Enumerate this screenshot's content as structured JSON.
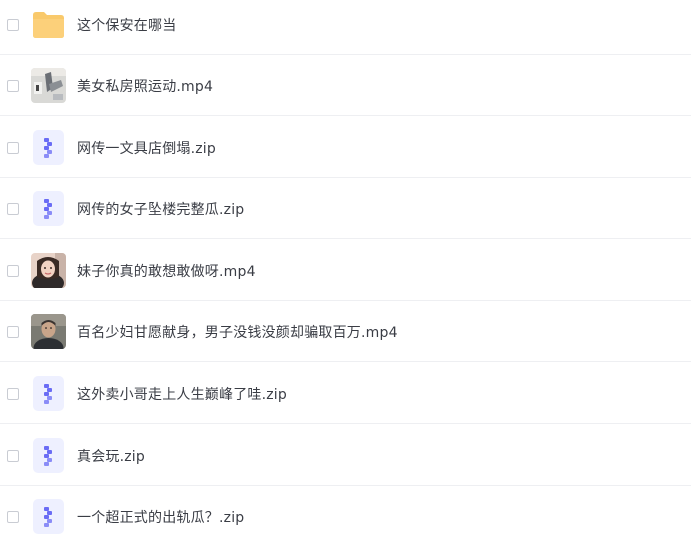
{
  "files": [
    {
      "name": "这个保安在哪当",
      "icon": "folder-icon"
    },
    {
      "name": "美女私房照运动.mp4",
      "icon": "video-thumbnail"
    },
    {
      "name": "网传一文具店倒塌.zip",
      "icon": "zip-icon"
    },
    {
      "name": "网传的女子坠楼完整瓜.zip",
      "icon": "zip-icon"
    },
    {
      "name": "妹子你真的敢想敢做呀.mp4",
      "icon": "video-thumbnail"
    },
    {
      "name": "百名少妇甘愿献身，男子没钱没颜却骗取百万.mp4",
      "icon": "video-thumbnail"
    },
    {
      "name": "这外卖小哥走上人生巅峰了哇.zip",
      "icon": "zip-icon"
    },
    {
      "name": "真会玩.zip",
      "icon": "zip-icon"
    },
    {
      "name": "一个超正式的出轨瓜？.zip",
      "icon": "zip-icon"
    }
  ],
  "colors": {
    "folder": "#f9c96b",
    "zip_bg": "#eef0ff",
    "zip_mark": "#6a6cf5",
    "text": "#3a3d45",
    "divider": "#eeeff2"
  }
}
